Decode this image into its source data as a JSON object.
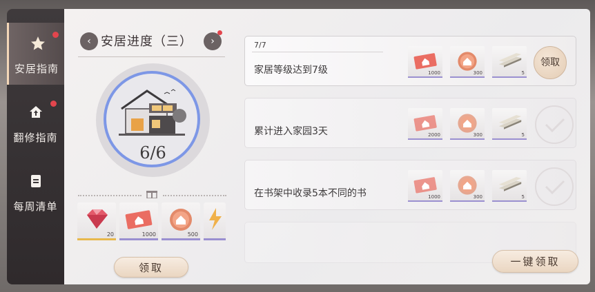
{
  "sidebar": {
    "items": [
      {
        "label": "安居指南",
        "icon": "star-icon",
        "active": true,
        "has_dot": true
      },
      {
        "label": "翻修指南",
        "icon": "home-up-icon",
        "active": false,
        "has_dot": true
      },
      {
        "label": "每周清单",
        "icon": "list-icon",
        "active": false,
        "has_dot": false
      }
    ]
  },
  "progress": {
    "title": "安居进度（三）",
    "count": "6/6",
    "rewards": [
      {
        "icon": "gem-icon",
        "qty": "20"
      },
      {
        "icon": "house-ticket-icon",
        "qty": "1000"
      },
      {
        "icon": "house-coin-icon",
        "qty": "500"
      },
      {
        "icon": "lightning-icon",
        "qty": ""
      }
    ],
    "claim_label": "领取"
  },
  "tasks": [
    {
      "progress": "7/7",
      "description": "家居等级达到7级",
      "rewards": [
        {
          "icon": "house-ticket-icon",
          "qty": "1000"
        },
        {
          "icon": "house-coin-icon",
          "qty": "300"
        },
        {
          "icon": "wood-plank-icon",
          "qty": "5"
        }
      ],
      "claim_label": "领取",
      "state": "claimable"
    },
    {
      "progress": "",
      "description": "累计进入家园3天",
      "rewards": [
        {
          "icon": "house-ticket-icon",
          "qty": "2000"
        },
        {
          "icon": "house-coin-icon",
          "qty": "300"
        },
        {
          "icon": "wood-plank-icon",
          "qty": "5"
        }
      ],
      "claim_label": "",
      "state": "claimed"
    },
    {
      "progress": "",
      "description": "在书架中收录5本不同的书",
      "rewards": [
        {
          "icon": "house-ticket-icon",
          "qty": "1000"
        },
        {
          "icon": "house-coin-icon",
          "qty": "300"
        },
        {
          "icon": "wood-plank-icon",
          "qty": "5"
        }
      ],
      "claim_label": "",
      "state": "claimed"
    }
  ],
  "claim_all_label": "一键领取",
  "colors": {
    "accent_ring": "#7d97e6",
    "notify_dot": "#e2454d",
    "claim_button": "#ead6c1"
  }
}
